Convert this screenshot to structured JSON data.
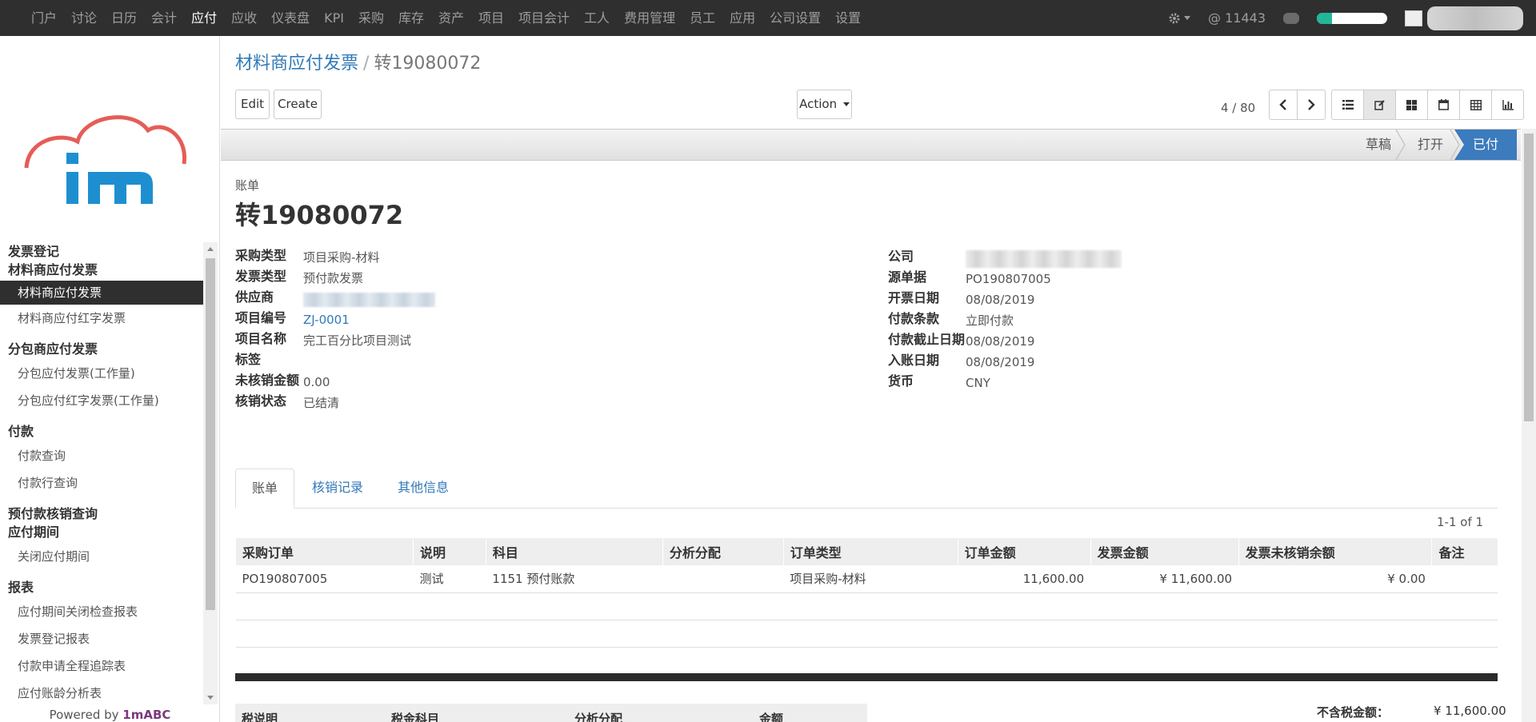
{
  "topbar": {
    "menu": [
      "门户",
      "讨论",
      "日历",
      "会计",
      "应付",
      "应收",
      "仪表盘",
      "KPI",
      "采购",
      "库存",
      "资产",
      "项目",
      "项目会计",
      "工人",
      "费用管理",
      "员工",
      "应用",
      "公司设置",
      "设置"
    ],
    "active_index": 4,
    "mentions": "@ 11443",
    "progress_fraction": 0.22,
    "icons": [
      "gear-icon",
      "chat-icon"
    ]
  },
  "sidebar": {
    "sections": [
      {
        "title": "发票登记",
        "items": []
      },
      {
        "title": "材料商应付发票",
        "items": [
          "材料商应付发票",
          "材料商应付红字发票"
        ],
        "active": 0
      },
      {
        "title": "分包商应付发票",
        "items": [
          "分包应付发票(工作量)",
          "分包应付红字发票(工作量)"
        ]
      },
      {
        "title": "付款",
        "items": [
          "付款查询",
          "付款行查询"
        ]
      },
      {
        "title": "预付款核销查询",
        "items": []
      },
      {
        "title": "应付期间",
        "items": [
          "关闭应付期间"
        ]
      },
      {
        "title": "报表",
        "items": [
          "应付期间关闭检查报表",
          "发票登记报表",
          "付款申请全程追踪表",
          "应付账龄分析表"
        ]
      }
    ],
    "powered_prefix": "Powered by ",
    "powered_brand": "1mABC"
  },
  "breadcrumb": {
    "parent": "材料商应付发票",
    "separator": "/",
    "current": "转19080072"
  },
  "toolbar": {
    "edit": "Edit",
    "create": "Create",
    "action": "Action",
    "pager": "4 / 80"
  },
  "status": {
    "stages": [
      "草稿",
      "打开",
      "已付"
    ],
    "active": 2
  },
  "form": {
    "doc_label": "账单",
    "doc_title": "转19080072",
    "left_fields": [
      {
        "label": "采购类型",
        "value": "项目采购-材料"
      },
      {
        "label": "发票类型",
        "value": "预付款发票"
      },
      {
        "label": "供应商",
        "value": ""
      },
      {
        "label": "项目编号",
        "value": "ZJ-0001"
      },
      {
        "label": "项目名称",
        "value": "完工百分比项目测试"
      },
      {
        "label": "标签",
        "value": ""
      },
      {
        "label": "未核销金额",
        "value": "0.00"
      },
      {
        "label": "核销状态",
        "value": "已结清"
      }
    ],
    "right_fields": [
      {
        "label": "公司",
        "value": ""
      },
      {
        "label": "源单据",
        "value": "PO190807005"
      },
      {
        "label": "开票日期",
        "value": "08/08/2019"
      },
      {
        "label": "付款条款",
        "value": "立即付款"
      },
      {
        "label": "付款截止日期",
        "value": "08/08/2019"
      },
      {
        "label": "入账日期",
        "value": "08/08/2019"
      },
      {
        "label": "货币",
        "value": "CNY"
      }
    ]
  },
  "tabs": [
    "账单",
    "核销记录",
    "其他信息"
  ],
  "lines": {
    "pager": "1-1 of 1",
    "headers": [
      "采购订单",
      "说明",
      "科目",
      "分析分配",
      "订单类型",
      "订单金额",
      "发票金额",
      "发票未核销余额",
      "备注"
    ],
    "rows": [
      [
        "PO190807005",
        "测试",
        "1151 预付账款",
        "",
        "项目采购-材料",
        "11,600.00",
        "¥ 11,600.00",
        "¥ 0.00",
        ""
      ]
    ]
  },
  "tax": {
    "headers": [
      "税说明",
      "税金科目",
      "分析分配",
      "金额"
    ],
    "untaxed_label": "不含税金额：",
    "untaxed_value": "¥ 11,600.00"
  }
}
